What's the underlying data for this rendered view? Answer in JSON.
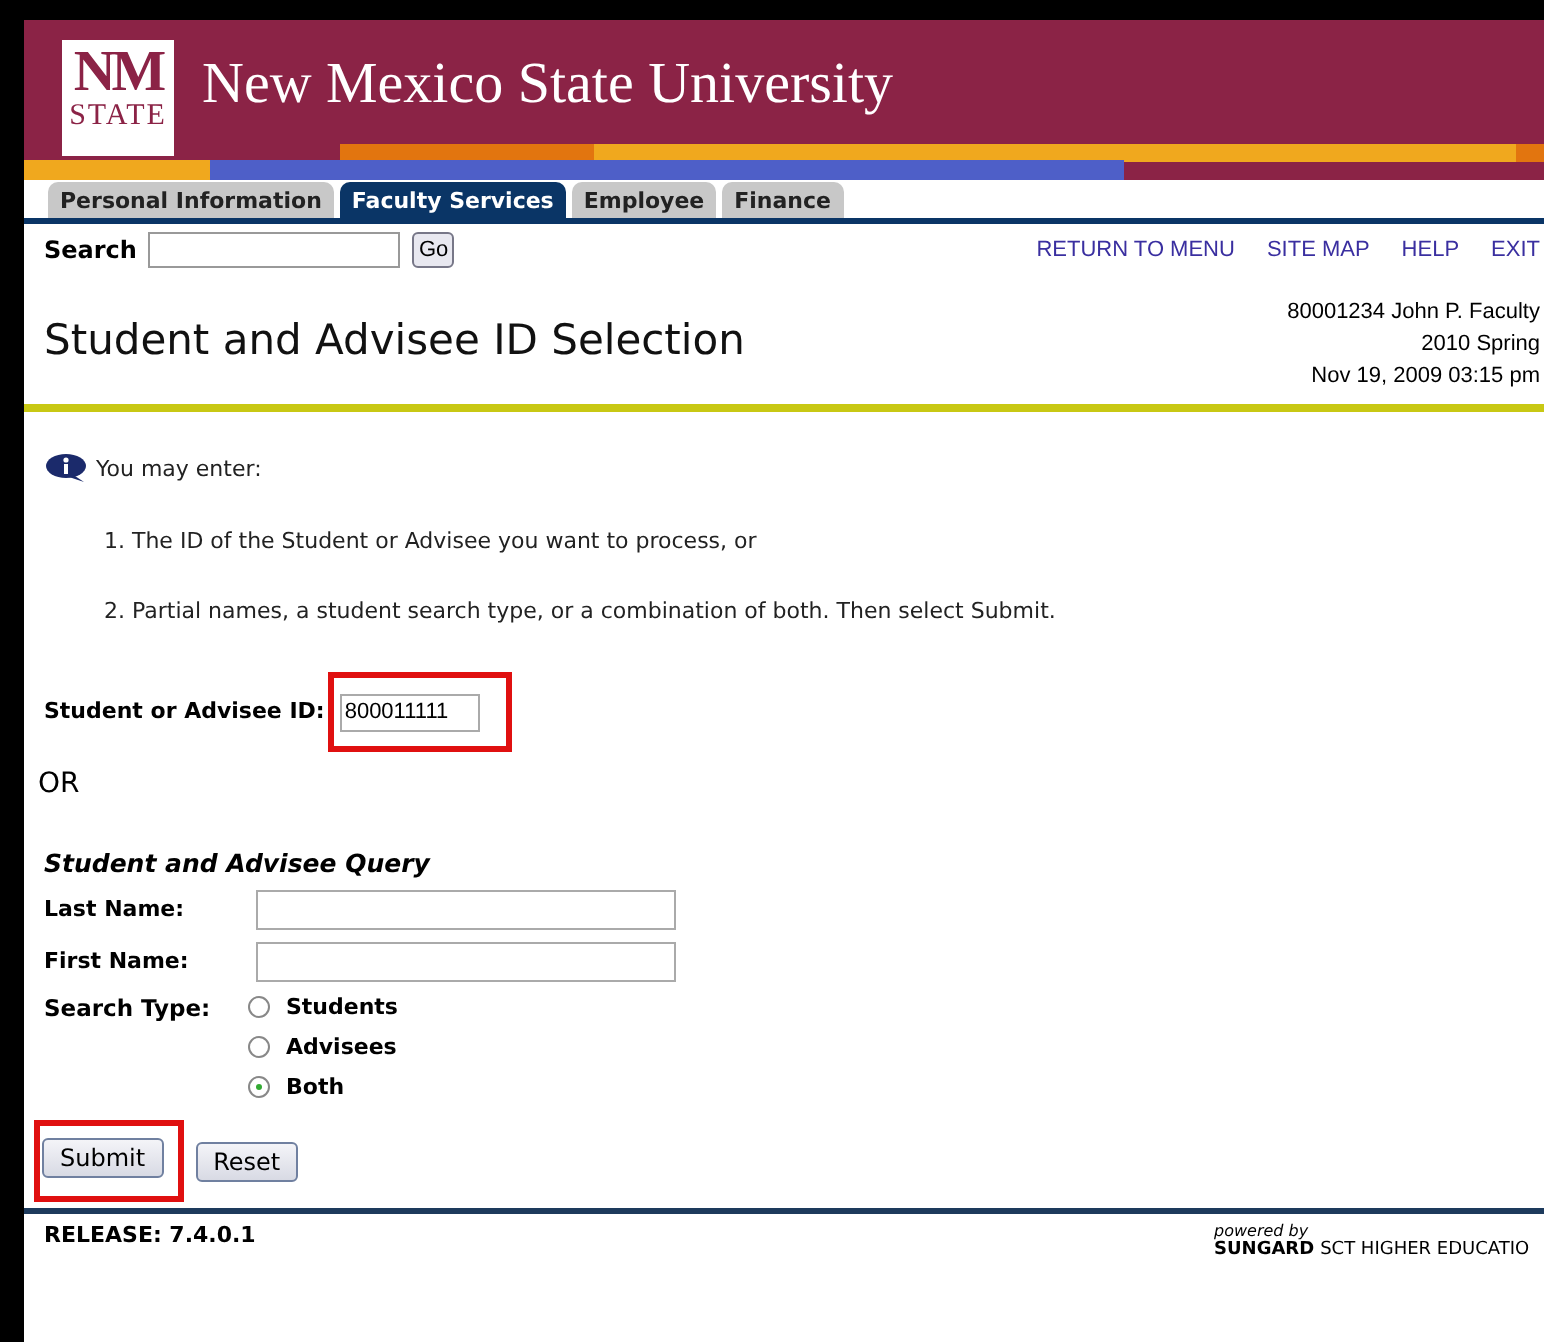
{
  "header": {
    "logo_top": "NM",
    "logo_bottom": "STATE",
    "title": "New Mexico State University"
  },
  "tabs": [
    {
      "label": "Personal Information",
      "selected": false
    },
    {
      "label": "Faculty Services",
      "selected": true
    },
    {
      "label": "Employee",
      "selected": false
    },
    {
      "label": "Finance",
      "selected": false
    }
  ],
  "search": {
    "label": "Search",
    "button": "Go"
  },
  "nav_links": [
    "RETURN TO MENU",
    "SITE MAP",
    "HELP",
    "EXIT"
  ],
  "page_title": "Student and Advisee ID Selection",
  "user_info": [
    "80001234 John P. Faculty",
    "2010 Spring",
    "Nov 19, 2009 03:15 pm"
  ],
  "info": {
    "text": "You may enter:",
    "steps": [
      "1. The ID of the Student or Advisee you want to process, or",
      "2. Partial names, a student search type, or a combination of both. Then select Submit."
    ]
  },
  "id_field": {
    "label": "Student or Advisee ID:",
    "value": "800011111",
    "highlighted": true
  },
  "or_label": "OR",
  "query": {
    "title": "Student and Advisee Query",
    "fields": [
      {
        "label": "Last Name:"
      },
      {
        "label": "First Name:"
      }
    ],
    "search_type": {
      "label": "Search Type:",
      "options": [
        {
          "label": "Students",
          "selected": false
        },
        {
          "label": "Advisees",
          "selected": false
        },
        {
          "label": "Both",
          "selected": true
        }
      ]
    }
  },
  "buttons": [
    {
      "label": "Submit",
      "highlighted": true
    },
    {
      "label": "Reset",
      "highlighted": false
    }
  ],
  "footer": {
    "release": "RELEASE: 7.4.0.1",
    "powered_by": "powered by",
    "vendor_brand": "SUNGARD",
    "vendor_rest": "SCT HIGHER EDUCATIO"
  }
}
